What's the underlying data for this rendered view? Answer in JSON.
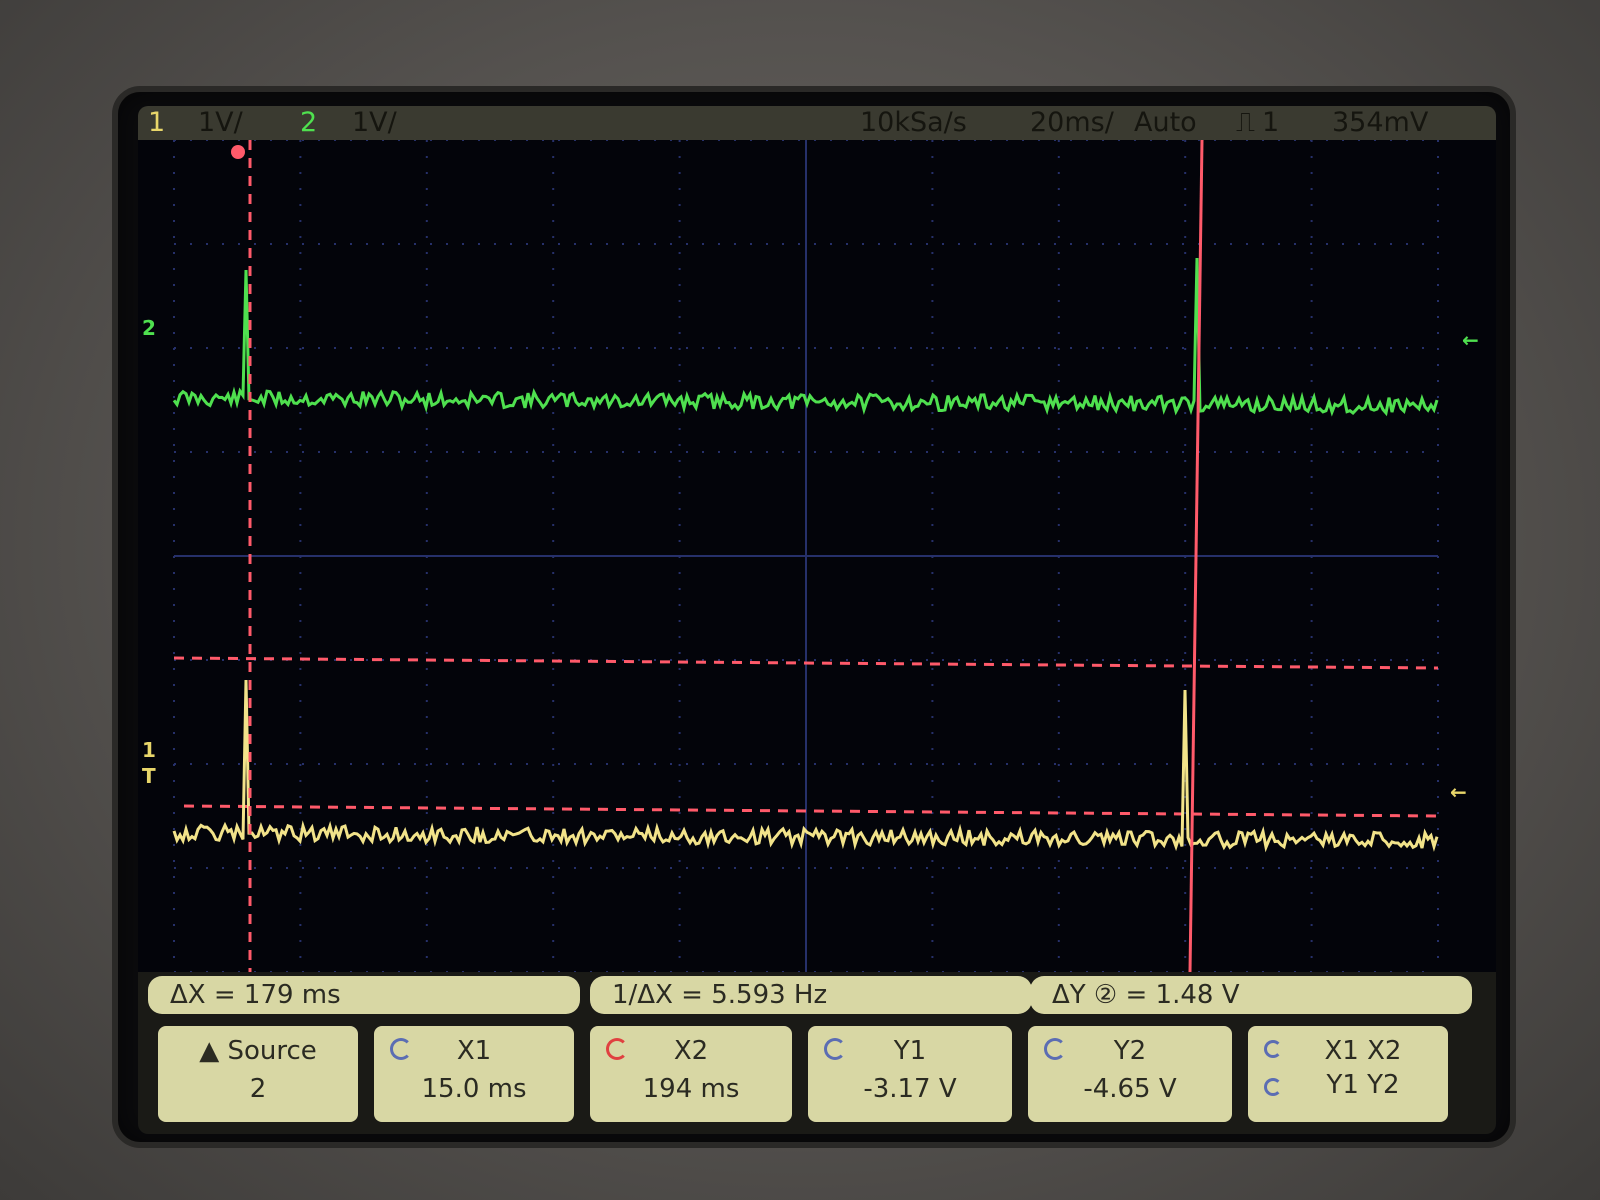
{
  "status": {
    "ch1_num": "1",
    "ch1_scale": "1V/",
    "ch2_num": "2",
    "ch2_scale": "1V/",
    "sample_rate": "10kSa/s",
    "timebase": "20ms/",
    "trigger_mode": "Auto",
    "trigger_source": "1",
    "trigger_level": "354mV"
  },
  "measurements": {
    "delta_x": "ΔX = 179 ms",
    "inv_delta_x": "1/ΔX = 5.593 Hz",
    "delta_y": "ΔY ② = 1.48 V"
  },
  "softkeys": {
    "source_label": "Source",
    "source_value": "2",
    "x1_label": "X1",
    "x1_value": "15.0 ms",
    "x2_label": "X2",
    "x2_value": "194 ms",
    "y1_label": "Y1",
    "y1_value": "-3.17 V",
    "y2_label": "Y2",
    "y2_value": "-4.65 V",
    "pair_x": "X1  X2",
    "pair_y": "Y1  Y2"
  },
  "markers": {
    "ch2_ground": "2",
    "ch1_ground": "1",
    "trigger": "T"
  },
  "colors": {
    "ch1": "#e8d66a",
    "ch2": "#4fe04f",
    "cursor": "#ff5a6a",
    "grid": "#2a3270"
  },
  "chart_data": {
    "type": "line",
    "xlabel": "",
    "ylabel": "",
    "series": [
      {
        "name": "1",
        "x_ms": [
          15.0,
          194
        ],
        "note_levels_v": [
          -3.17,
          -4.65
        ]
      },
      {
        "name": "2"
      }
    ]
  }
}
